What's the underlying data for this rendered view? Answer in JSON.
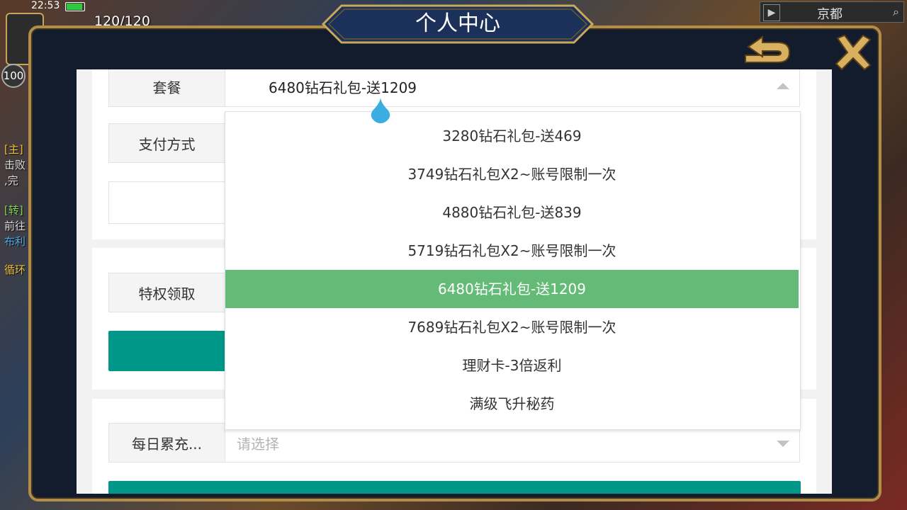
{
  "status_bar": {
    "time": "22:53"
  },
  "hud": {
    "counter": "120/120",
    "level": "100",
    "city": "京都"
  },
  "side_quests": [
    "[主]",
    "击败",
    ",完",
    "[转]",
    "前往",
    "布利",
    "循环"
  ],
  "panel": {
    "title": "个人中心"
  },
  "form": {
    "package": {
      "label": "套餐",
      "value": "6480钻石礼包-送1209"
    },
    "payment": {
      "label": "支付方式"
    },
    "privilege": {
      "label": "特权领取"
    },
    "daily": {
      "label": "每日累充...",
      "placeholder": "请选择"
    }
  },
  "dropdown": {
    "selected_index": 4,
    "options": [
      "3280钻石礼包-送469",
      "3749钻石礼包X2~账号限制一次",
      "4880钻石礼包-送839",
      "5719钻石礼包X2~账号限制一次",
      "6480钻石礼包-送1209",
      "7689钻石礼包X2~账号限制一次",
      "理财卡-3倍返利",
      "满级飞升秘药"
    ]
  },
  "colors": {
    "panel_border": "#b08d4a",
    "panel_bg": "#131c2c",
    "selected_option": "#63bb77",
    "button_teal": "#009688",
    "drop_handle": "#3aaee0"
  },
  "icons": {
    "back": "return-arrow-icon",
    "close": "close-icon",
    "caret_up": "caret-up-icon",
    "caret_down": "caret-down-icon",
    "text_handle": "text-selection-handle-icon"
  }
}
